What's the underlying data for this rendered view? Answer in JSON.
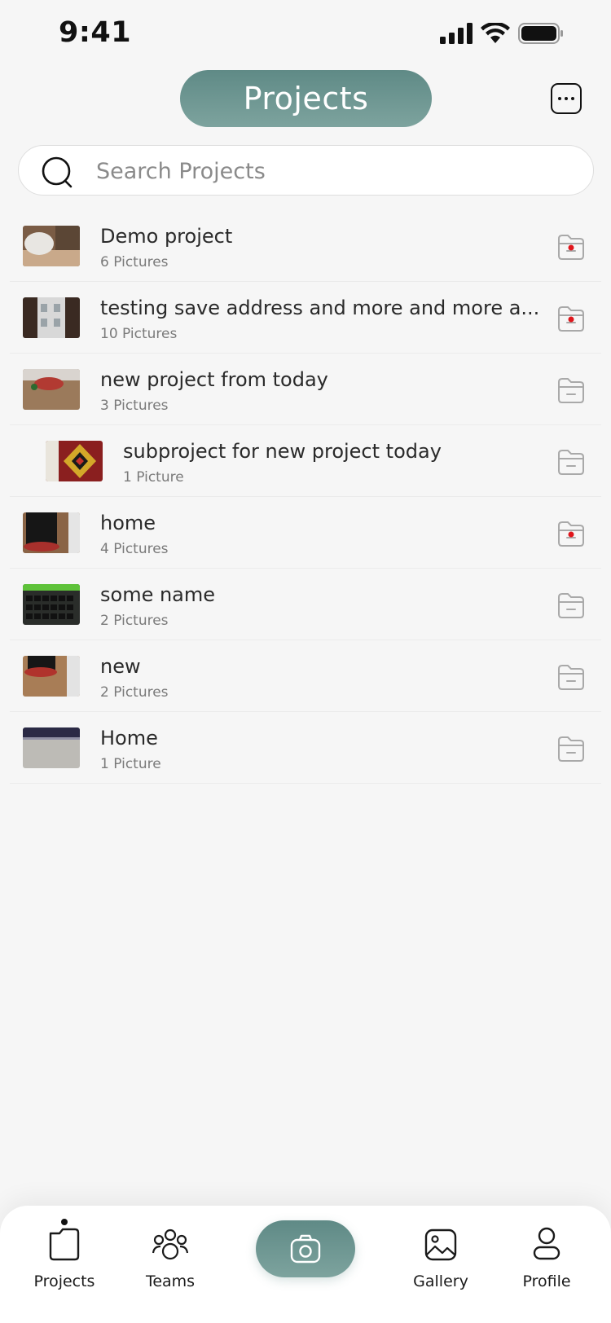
{
  "status_bar": {
    "time": "9:41"
  },
  "header": {
    "title": "Projects"
  },
  "search": {
    "placeholder": "Search Projects"
  },
  "projects": [
    {
      "name": "Demo project",
      "count": "6 Pictures",
      "has_dot": true,
      "indent": false
    },
    {
      "name": "testing save address and more and more a...",
      "count": "10 Pictures",
      "has_dot": true,
      "indent": false
    },
    {
      "name": "new project from today",
      "count": "3 Pictures",
      "has_dot": false,
      "indent": false
    },
    {
      "name": "subproject for new project today",
      "count": "1 Picture",
      "has_dot": false,
      "indent": true
    },
    {
      "name": "home",
      "count": "4 Pictures",
      "has_dot": true,
      "indent": false
    },
    {
      "name": "some name",
      "count": "2 Pictures",
      "has_dot": false,
      "indent": false
    },
    {
      "name": "new",
      "count": "2 Pictures",
      "has_dot": false,
      "indent": false
    },
    {
      "name": "Home",
      "count": "1 Picture",
      "has_dot": false,
      "indent": false
    }
  ],
  "nav": {
    "projects": "Projects",
    "teams": "Teams",
    "gallery": "Gallery",
    "profile": "Profile"
  },
  "colors": {
    "accent": "#6b948f",
    "dot": "#e0161c"
  }
}
